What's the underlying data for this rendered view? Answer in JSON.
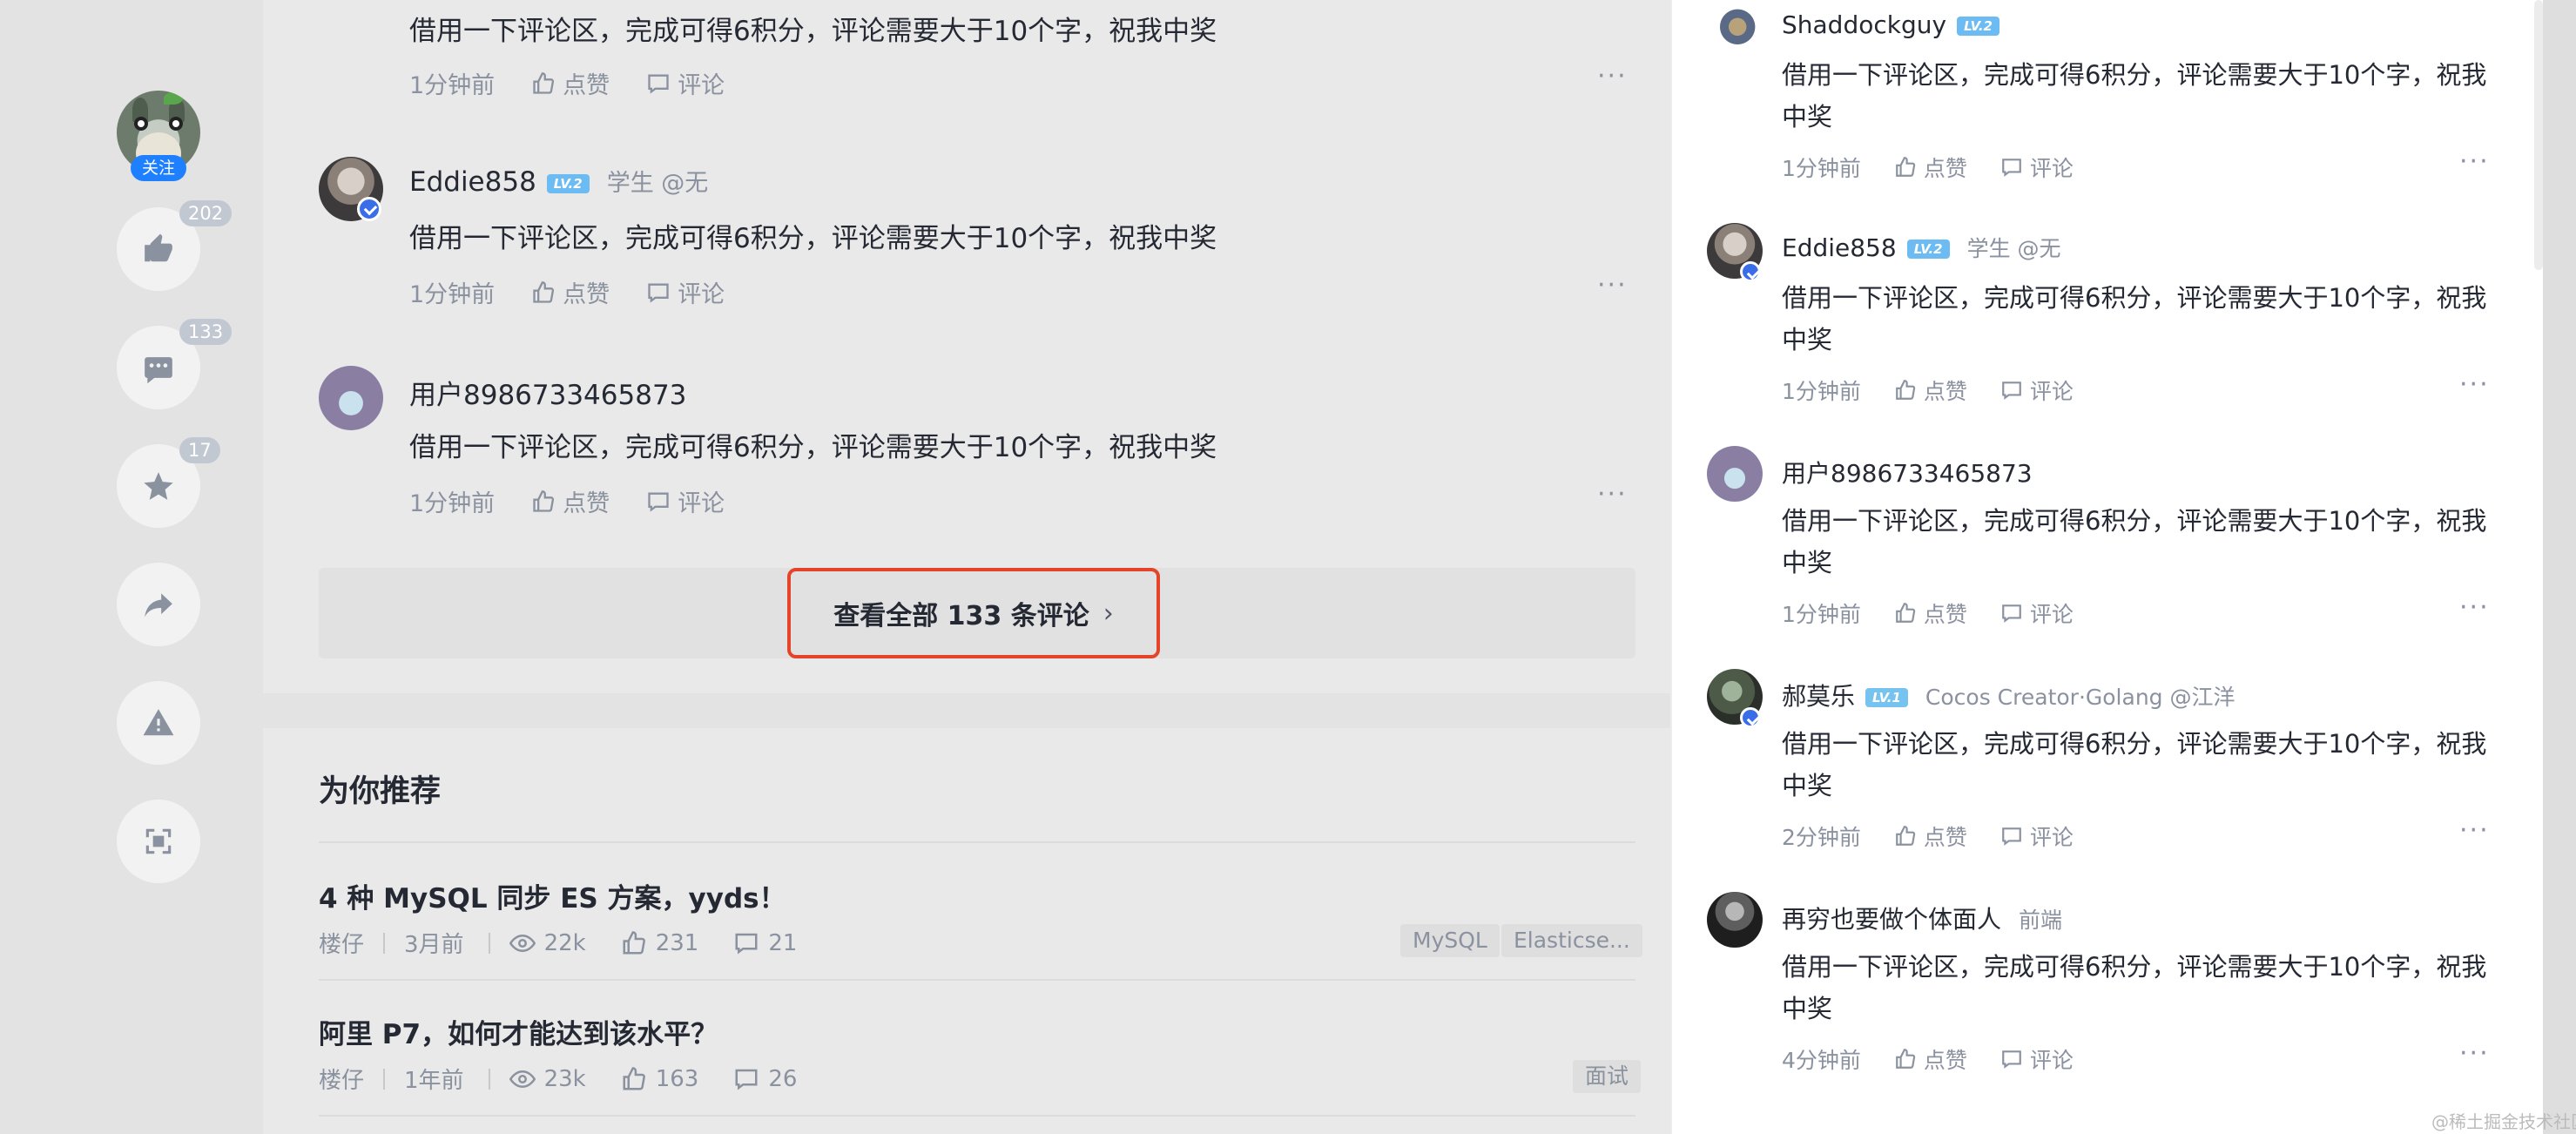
{
  "action_bar": {
    "follow_label": "关注",
    "like_count": "202",
    "comment_count": "133",
    "collect_count": "17"
  },
  "main_comments": [
    {
      "text": "借用一下评论区，完成可得6积分，评论需要大于10个字，祝我中奖",
      "time": "1分钟前",
      "like_label": "点赞",
      "reply_label": "评论"
    },
    {
      "name": "Eddie858",
      "level": "LV.2",
      "job": "学生 @无",
      "text": "借用一下评论区，完成可得6积分，评论需要大于10个字，祝我中奖",
      "time": "1分钟前",
      "like_label": "点赞",
      "reply_label": "评论"
    },
    {
      "name": "用户8986733465873",
      "text": "借用一下评论区，完成可得6积分，评论需要大于10个字，祝我中奖",
      "time": "1分钟前",
      "like_label": "点赞",
      "reply_label": "评论"
    }
  ],
  "view_all": {
    "label": "查看全部 133 条评论",
    "chevron": "›"
  },
  "recommend": {
    "title": "为你推荐",
    "articles": [
      {
        "title": "4 种 MySQL 同步 ES 方案，yyds！",
        "author": "楼仔",
        "time": "3月前",
        "views": "22k",
        "likes": "231",
        "comments": "21",
        "tags": [
          "MySQL",
          "Elasticse..."
        ]
      },
      {
        "title": "阿里 P7，如何才能达到该水平？",
        "author": "楼仔",
        "time": "1年前",
        "views": "23k",
        "likes": "163",
        "comments": "26",
        "tags": [
          "面试"
        ]
      }
    ]
  },
  "drawer_comments": [
    {
      "name": "Shaddockguy",
      "level": "LV.2",
      "job": "",
      "text": "借用一下评论区，完成可得6积分，评论需要大于10个字，祝我中奖",
      "time": "1分钟前",
      "like_label": "点赞",
      "reply_label": "评论"
    },
    {
      "name": "Eddie858",
      "level": "LV.2",
      "job": "学生 @无",
      "text": "借用一下评论区，完成可得6积分，评论需要大于10个字，祝我中奖",
      "time": "1分钟前",
      "like_label": "点赞",
      "reply_label": "评论"
    },
    {
      "name": "用户8986733465873",
      "level": "",
      "job": "",
      "text": "借用一下评论区，完成可得6积分，评论需要大于10个字，祝我中奖",
      "time": "1分钟前",
      "like_label": "点赞",
      "reply_label": "评论"
    },
    {
      "name": "郝莫乐",
      "level": "LV.1",
      "job": "Cocos Creator·Golang @江洋",
      "text": "借用一下评论区，完成可得6积分，评论需要大于10个字，祝我中奖",
      "time": "2分钟前",
      "like_label": "点赞",
      "reply_label": "评论"
    },
    {
      "name": "再穷也要做个体面人",
      "level": "",
      "job": "前端",
      "text": "借用一下评论区，完成可得6积分，评论需要大于10个字，祝我中奖",
      "time": "4分钟前",
      "like_label": "点赞",
      "reply_label": "评论"
    }
  ],
  "watermark": "@稀土掘金技术社区",
  "colors": {
    "accent": "#1e80ff",
    "highlight_border": "#e5442b",
    "muted": "#8a919f"
  }
}
